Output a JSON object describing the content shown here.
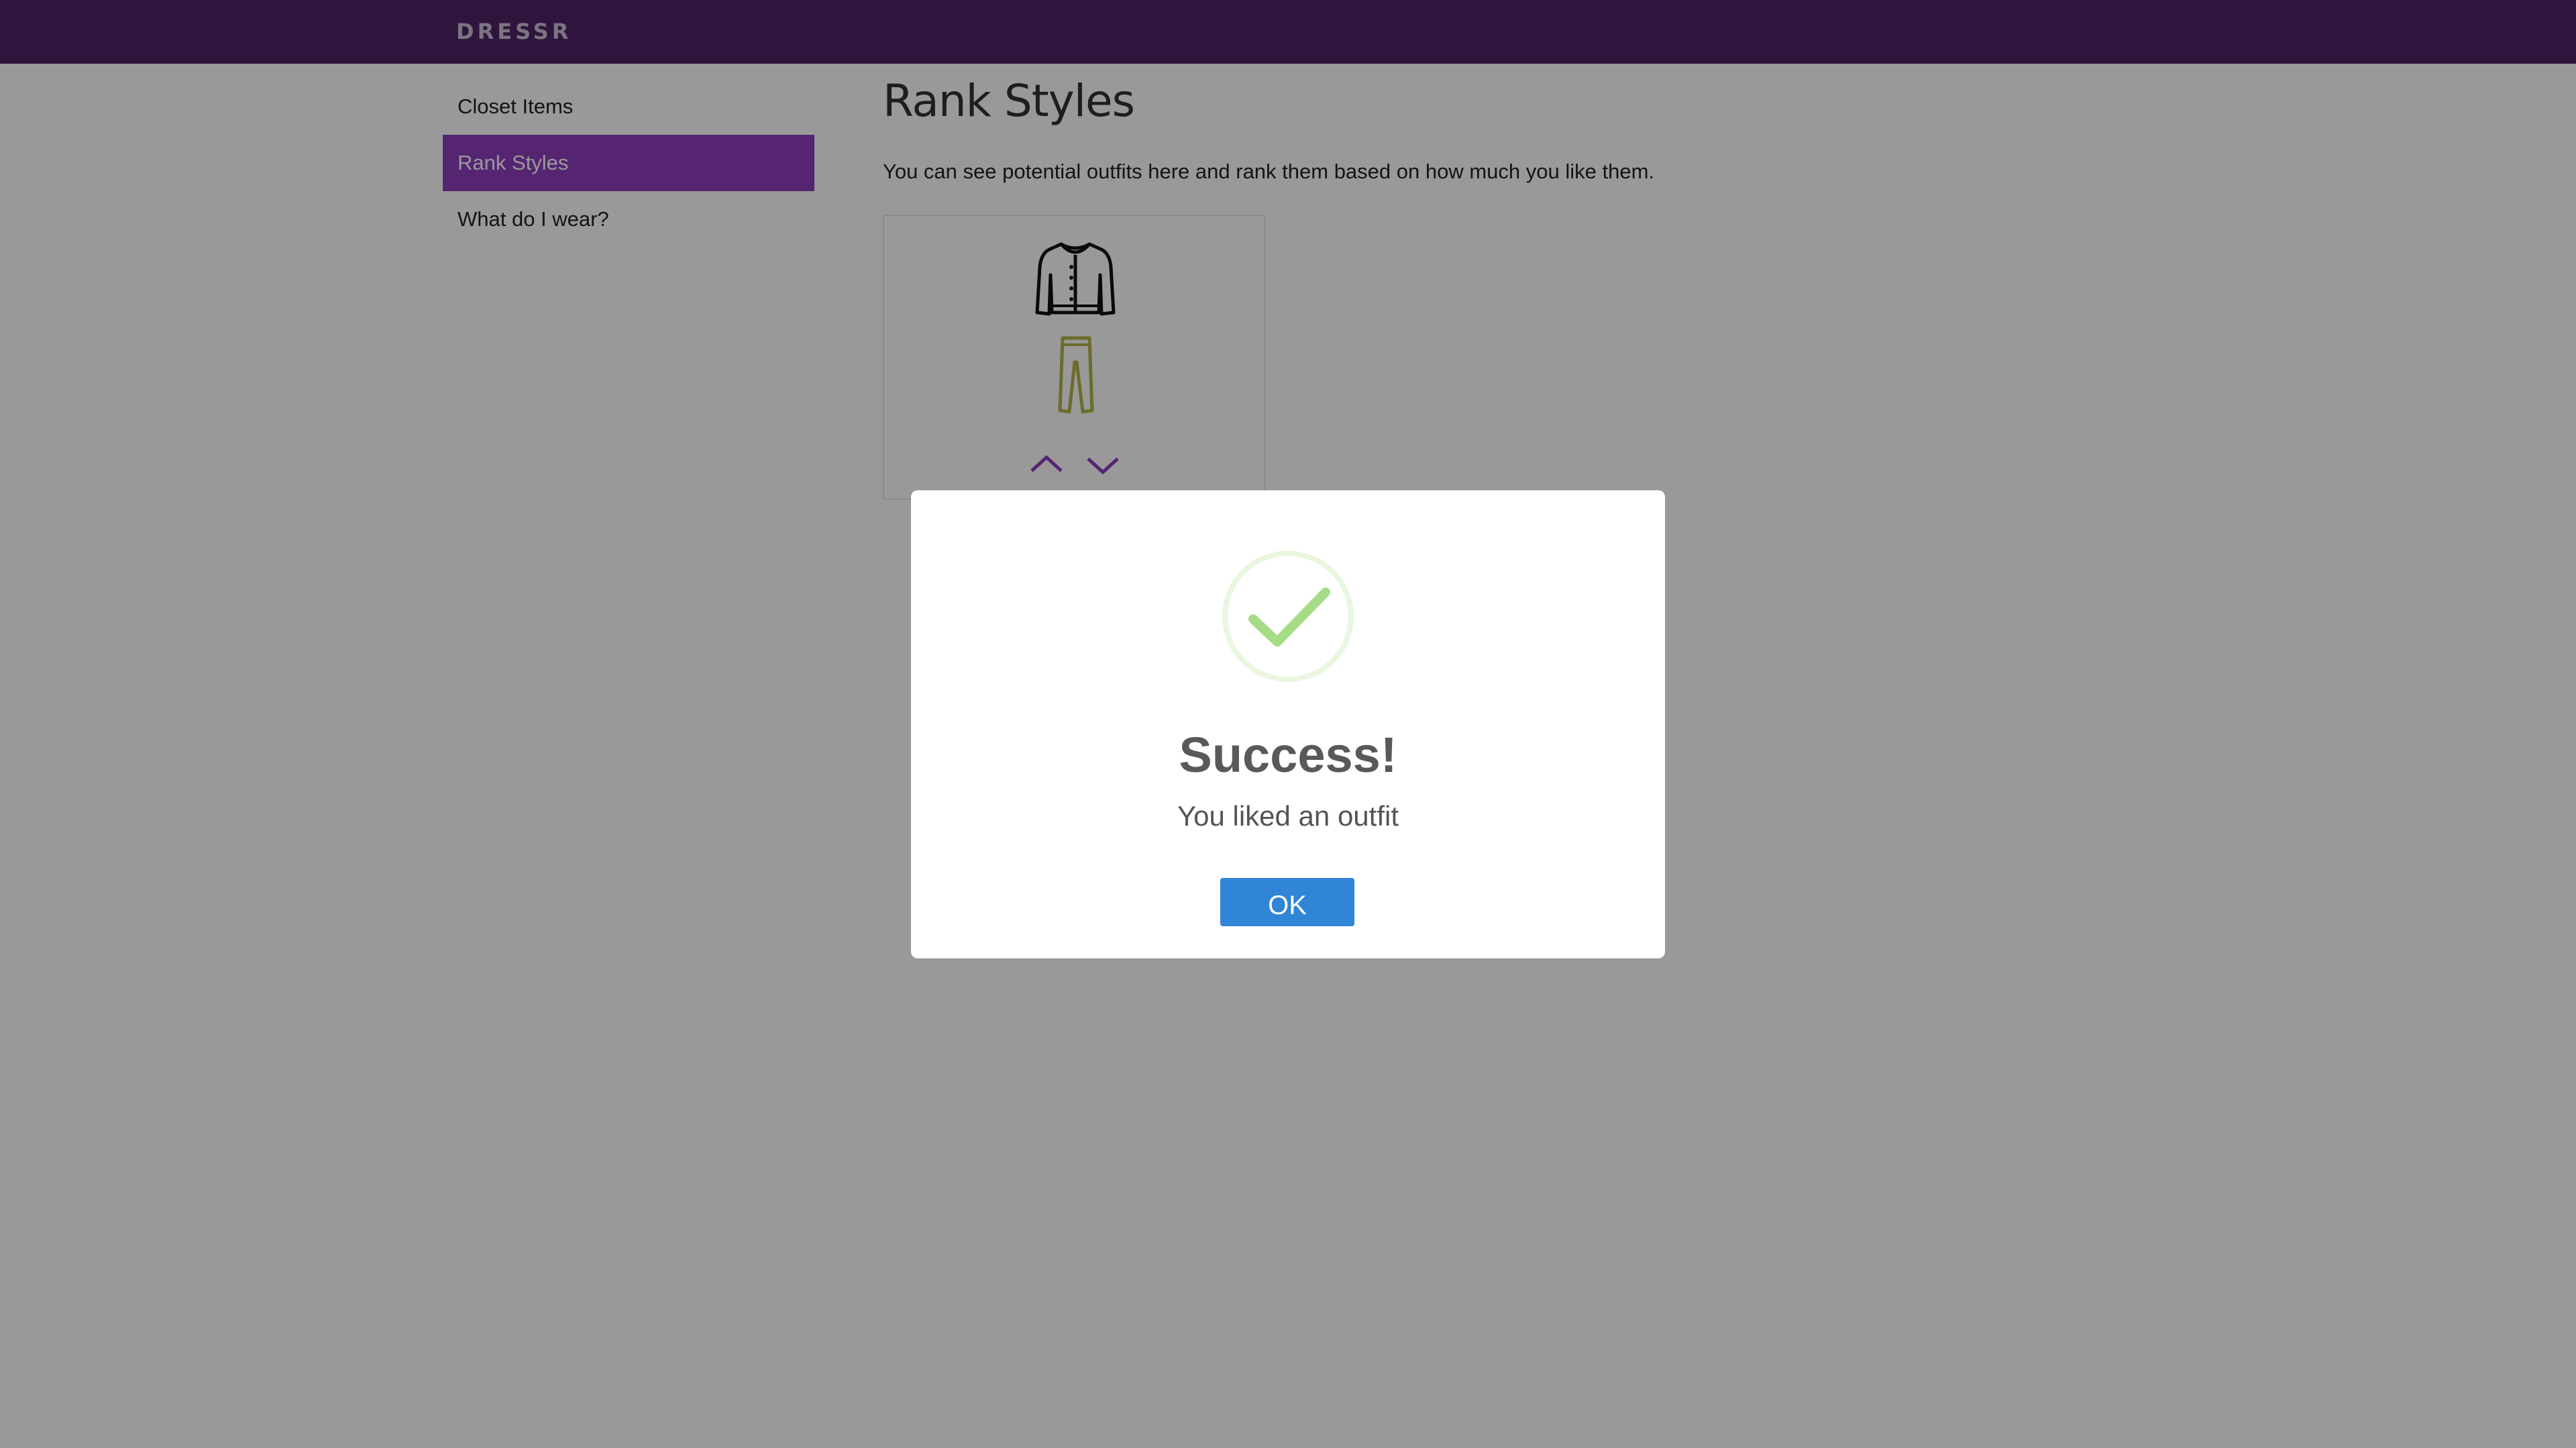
{
  "app": {
    "brand": "DRESSR"
  },
  "sidebar": {
    "items": [
      {
        "label": "Closet Items"
      },
      {
        "label": "Rank Styles",
        "active": true
      },
      {
        "label": "What do I wear?"
      }
    ]
  },
  "main": {
    "title": "Rank Styles",
    "description": "You can see potential outfits here and rank them based on how much you like them.",
    "outfit": {
      "items": [
        "cardigan-icon",
        "pants-icon"
      ],
      "rank_controls": [
        "chevron-up-icon",
        "chevron-down-icon"
      ]
    }
  },
  "modal": {
    "icon": "success-check-icon",
    "title": "Success!",
    "text": "You liked an outfit",
    "ok_label": "OK"
  },
  "colors": {
    "brand": "#4f2367",
    "sidebar_active": "#8e3fbf",
    "check": "#a5dc86",
    "ok_button": "#3085d6"
  }
}
